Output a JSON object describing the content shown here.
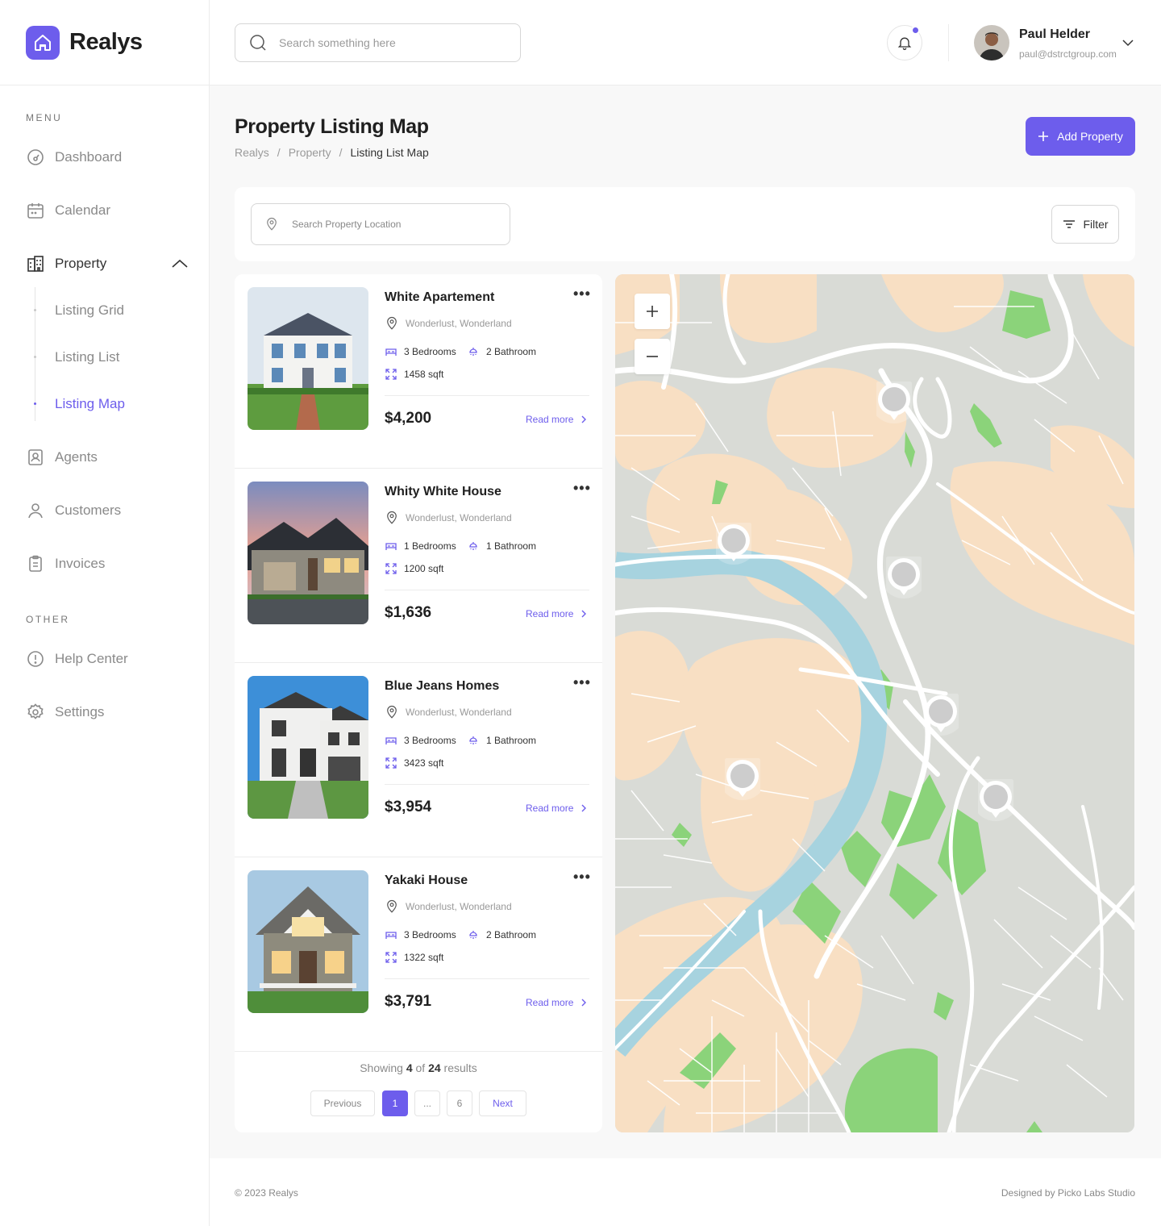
{
  "app": {
    "name": "Realys"
  },
  "sidebar": {
    "menu_label": "MENU",
    "other_label": "OTHER",
    "items": {
      "dashboard": "Dashboard",
      "calendar": "Calendar",
      "property": "Property",
      "listing_grid": "Listing Grid",
      "listing_list": "Listing List",
      "listing_map": "Listing Map",
      "agents": "Agents",
      "customers": "Customers",
      "invoices": "Invoices",
      "help_center": "Help Center",
      "settings": "Settings"
    },
    "active": "listing_map"
  },
  "header": {
    "search_placeholder": "Search something here",
    "user": {
      "name": "Paul Helder",
      "email": "paul@dstrctgroup.com"
    }
  },
  "page": {
    "title": "Property Listing Map",
    "breadcrumb": [
      "Realys",
      "/",
      "Property",
      "/",
      "Listing List Map"
    ],
    "add_button": "Add Property",
    "location_placeholder": "Search Property Location",
    "filter_label": "Filter"
  },
  "listings": [
    {
      "title": "White Apartement",
      "location": "Wonderlust, Wonderland",
      "bedrooms": "3 Bedrooms",
      "bathrooms": "2 Bathroom",
      "area": "1458 sqft",
      "price": "$4,200",
      "cta": "Read more"
    },
    {
      "title": "Whity White House",
      "location": "Wonderlust, Wonderland",
      "bedrooms": "1 Bedrooms",
      "bathrooms": "1 Bathroom",
      "area": "1200 sqft",
      "price": "$1,636",
      "cta": "Read more"
    },
    {
      "title": "Blue Jeans Homes",
      "location": "Wonderlust, Wonderland",
      "bedrooms": "3 Bedrooms",
      "bathrooms": "1 Bathroom",
      "area": "3423 sqft",
      "price": "$3,954",
      "cta": "Read more"
    },
    {
      "title": "Yakaki House",
      "location": "Wonderlust, Wonderland",
      "bedrooms": "3 Bedrooms",
      "bathrooms": "2 Bathroom",
      "area": "1322 sqft",
      "price": "$3,791",
      "cta": "Read more"
    }
  ],
  "pagination": {
    "showing_prefix": "Showing",
    "shown": "4",
    "of": "of",
    "total": "24",
    "suffix": "results",
    "previous": "Previous",
    "pages": [
      "1",
      "...",
      "6"
    ],
    "next": "Next",
    "current": "1"
  },
  "map": {
    "zoom_in": "+",
    "zoom_out": "−"
  },
  "footer": {
    "copyright": "© 2023 Realys",
    "credit": "Designed by Picko Labs Studio"
  },
  "colors": {
    "accent": "#6d5dec",
    "water": "#a7d3df",
    "park": "#8bd37a",
    "urban": "#f8dfc3",
    "land": "#d9dbd6"
  }
}
